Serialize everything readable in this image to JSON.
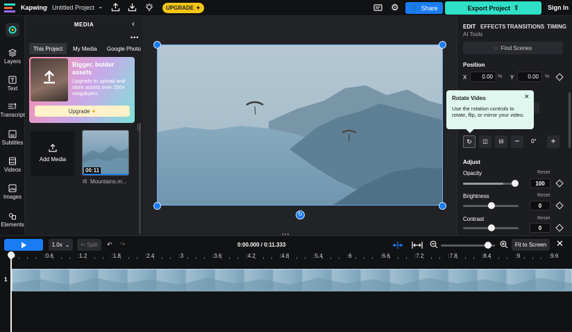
{
  "topbar": {
    "brand": "Kapwing",
    "project_title": "Untitled Project",
    "upgrade": "UPGRADE",
    "share": "Share",
    "export": "Export Project",
    "signin": "Sign In"
  },
  "nav": [
    {
      "label": "Layers",
      "icon": "layers-icon"
    },
    {
      "label": "Text",
      "icon": "text-icon"
    },
    {
      "label": "Transcript",
      "icon": "transcript-icon"
    },
    {
      "label": "Subtitles",
      "icon": "subtitles-icon"
    },
    {
      "label": "Videos",
      "icon": "videos-icon"
    },
    {
      "label": "Images",
      "icon": "images-icon"
    },
    {
      "label": "Elements",
      "icon": "elements-icon"
    }
  ],
  "media": {
    "title": "MEDIA",
    "tabs": [
      "This Project",
      "My Media",
      "Google Photo"
    ],
    "promo_title": "Bigger, bolder assets",
    "promo_body": "Upgrade to upload and store assets over 250+ megabytes",
    "promo_button": "Upgrade",
    "add_media": "Add Media",
    "clip_duration": "00:11",
    "clip_name": "Mountains.m..."
  },
  "right": {
    "tabs": [
      "EDIT",
      "EFFECTS",
      "TRANSITIONS",
      "TIMING"
    ],
    "ai_tools": "AI Tools",
    "find_scenes": "Find Scenes",
    "position_label": "Position",
    "x_label": "X",
    "x_value": "0.00",
    "y_label": "Y",
    "y_value": "0.00",
    "pct": "%",
    "tooltip_title": "Rotate Video",
    "tooltip_body": "Use the rotation controls to rotate, flip, or mirror your video.",
    "rotation_value": "0°",
    "adjust_label": "Adjust",
    "opacity_label": "Opacity",
    "opacity_value": "100",
    "opacity_level": 100,
    "brightness_label": "Brightness",
    "brightness_value": "0",
    "contrast_label": "Contrast",
    "contrast_value": "0",
    "reset": "Reset"
  },
  "timeline": {
    "speed": "1.0x",
    "split": "Split",
    "time": "0:00.000 / 0:11.333",
    "fit": "Fit to Screen",
    "track_number": "1",
    "ticks": [
      ":0",
      ":0.6",
      ":1.2",
      ":1.8",
      ":2.4",
      ":3",
      ":3.6",
      ":4.2",
      ":4.8",
      ":5.4",
      ":6",
      ":6.6",
      ":7.2",
      ":7.8",
      ":8.4",
      ":9",
      ":9.6"
    ]
  },
  "colors": {
    "accent_blue": "#1a7cf2",
    "export_teal": "#2fe0c6",
    "upgrade_yellow": "#f5c518",
    "tooltip_bg": "#dff7ef"
  }
}
